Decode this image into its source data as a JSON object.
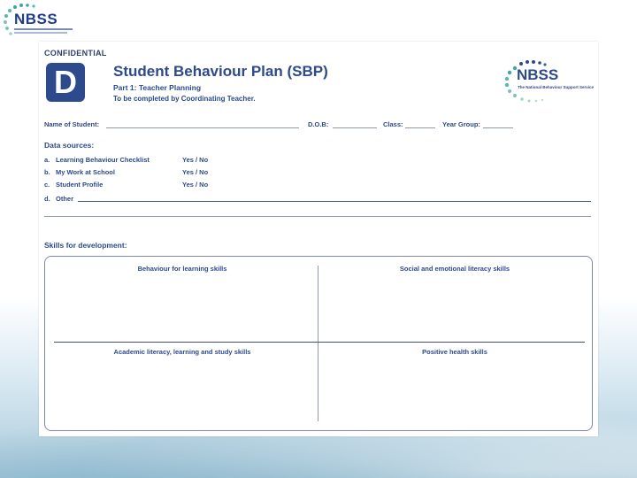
{
  "header_logo": {
    "text": "NBSS"
  },
  "document": {
    "confidential": "CONFIDENTIAL",
    "badge_letter": "D",
    "title": "Student Behaviour Plan (SBP)",
    "subtitle": "Part 1: Teacher Planning",
    "instruction": "To be completed by Coordinating Teacher.",
    "logo_text": "NBSS",
    "logo_tagline": "The National Behaviour Support Service",
    "fields": {
      "name": "Name of Student:",
      "dob": "D.O.B:",
      "class": "Class:",
      "year_group": "Year Group:"
    },
    "data_sources": {
      "heading": "Data sources:",
      "items": [
        {
          "letter": "a.",
          "label": "Learning Behaviour Checklist",
          "answer": "Yes / No"
        },
        {
          "letter": "b.",
          "label": "My Work at School",
          "answer": "Yes / No"
        },
        {
          "letter": "c.",
          "label": "Student Profile",
          "answer": "Yes / No"
        }
      ],
      "other_letter": "d.",
      "other_label": "Other"
    },
    "skills": {
      "heading": "Skills for development:",
      "cells": [
        "Behaviour for learning skills",
        "Social and emotional literacy skills",
        "Academic literacy, learning and study skills",
        "Positive health skills"
      ]
    }
  },
  "colors": {
    "brand": "#2c4a8c",
    "logo_blue": "#1f3c88",
    "dot_teal": "#3ea6a0"
  }
}
